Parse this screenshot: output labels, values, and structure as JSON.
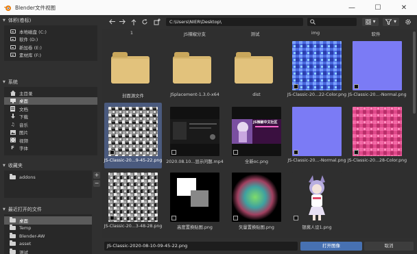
{
  "window": {
    "title": "Blender文件视图",
    "minimize": "—",
    "maximize": "☐",
    "close": "✕"
  },
  "sidebar": {
    "volumes": {
      "header": "体积(卷标)",
      "items": [
        {
          "label": "本地磁盘 (C:)",
          "icon": "drive-icon"
        },
        {
          "label": "软件 (D:)",
          "icon": "drive-icon"
        },
        {
          "label": "新加卷 (E:)",
          "icon": "drive-icon"
        },
        {
          "label": "素材库 (F:)",
          "icon": "drive-icon"
        }
      ]
    },
    "system": {
      "header": "系统",
      "items": [
        {
          "label": "主目录",
          "icon": "home-icon"
        },
        {
          "label": "桌面",
          "icon": "desktop-icon",
          "active": true
        },
        {
          "label": "文档",
          "icon": "document-icon"
        },
        {
          "label": "下载",
          "icon": "download-icon"
        },
        {
          "label": "音乐",
          "icon": "music-icon"
        },
        {
          "label": "图片",
          "icon": "image-icon"
        },
        {
          "label": "视频",
          "icon": "video-icon"
        },
        {
          "label": "字体",
          "icon": "font-icon"
        }
      ]
    },
    "bookmarks": {
      "header": "收藏夹",
      "items": [
        {
          "label": "addons",
          "icon": "folder-icon"
        }
      ],
      "add": "+",
      "remove": "−"
    },
    "recent": {
      "header": "最近打开的文件",
      "items": [
        {
          "label": "桌面",
          "icon": "folder-icon",
          "active": true
        },
        {
          "label": "Temp",
          "icon": "folder-icon"
        },
        {
          "label": "Blender-AW",
          "icon": "folder-icon"
        },
        {
          "label": "asset",
          "icon": "folder-icon"
        },
        {
          "label": "测试",
          "icon": "folder-icon"
        }
      ]
    }
  },
  "toolbar": {
    "path": "C:\\Users\\NIER\\Desktop\\",
    "search_placeholder": "",
    "back_icon": "arrow-left-icon",
    "forward_icon": "arrow-right-icon",
    "parent_icon": "arrow-up-icon",
    "refresh_icon": "refresh-icon",
    "new_folder_icon": "new-folder-icon",
    "view_icon": "grid-view-icon",
    "filter_icon": "filter-icon",
    "settings_icon": "gear-icon"
  },
  "files": {
    "top_labels": [
      "1",
      "JS辣椒分支",
      "测试",
      "img",
      "软件"
    ],
    "row1": [
      "封面源文件",
      "JSplacement-1.3.0-x64",
      "dist",
      "JS-Classic-20...22-Color.png",
      "JS-Classic-20...-Normal.png"
    ],
    "row2": [
      "JS-Classic-20...9-45-22.png",
      "2020.08.10...显示问题.mp4",
      "全新oc.png",
      "JS-Classic-20...-Normal.png",
      "JS-Classic-20...28-Color.png"
    ],
    "row3": [
      "JS-Classic-20...3-48-28.png",
      "高度置换贴图.png",
      "矢量置换贴图.png",
      "银酱人设1.png"
    ],
    "banner_text": "JS辣椒中文社区"
  },
  "footer": {
    "filename": "JS-Classic-2020-08-10-09-45-22.png",
    "open_label": "打开图像",
    "cancel_label": "取消"
  },
  "colors": {
    "accent": "#4771b2",
    "selection": "#4a5a7e",
    "normal_map": "#7b7bf5",
    "folder": "#e2c27c"
  }
}
